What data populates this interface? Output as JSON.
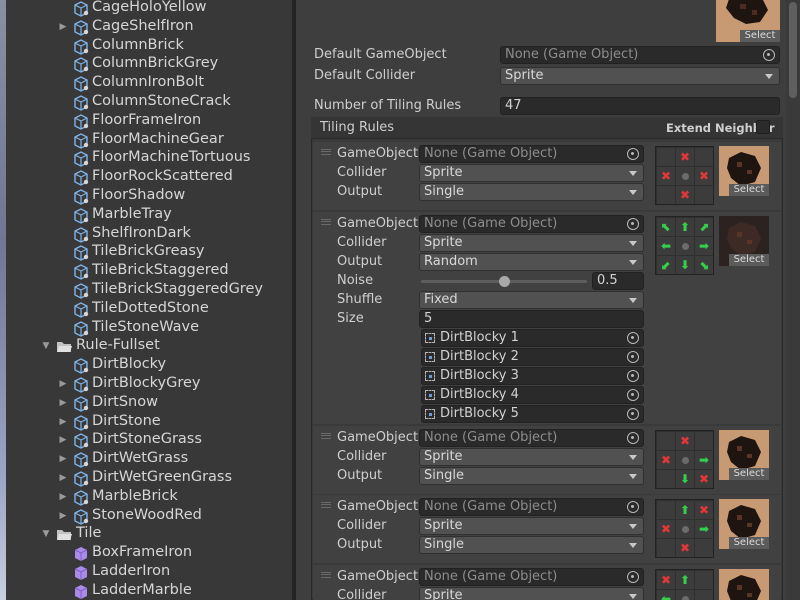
{
  "hierarchy": {
    "items": [
      {
        "label": "CageHoloYellow",
        "kind": "tile",
        "arrow": false
      },
      {
        "label": "CageShelfIron",
        "kind": "tile",
        "arrow": true
      },
      {
        "label": "ColumnBrick",
        "kind": "tile",
        "arrow": false
      },
      {
        "label": "ColumnBrickGrey",
        "kind": "tile",
        "arrow": false
      },
      {
        "label": "ColumnIronBolt",
        "kind": "tile",
        "arrow": false
      },
      {
        "label": "ColumnStoneCrack",
        "kind": "tile",
        "arrow": false
      },
      {
        "label": "FloorFrameIron",
        "kind": "tile",
        "arrow": false
      },
      {
        "label": "FloorMachineGear",
        "kind": "tile",
        "arrow": false
      },
      {
        "label": "FloorMachineTortuous",
        "kind": "tile",
        "arrow": false
      },
      {
        "label": "FloorRockScattered",
        "kind": "tile",
        "arrow": false
      },
      {
        "label": "FloorShadow",
        "kind": "tile",
        "arrow": false
      },
      {
        "label": "MarbleTray",
        "kind": "tile",
        "arrow": false
      },
      {
        "label": "ShelfIronDark",
        "kind": "tile",
        "arrow": false
      },
      {
        "label": "TileBrickGreasy",
        "kind": "tile",
        "arrow": false
      },
      {
        "label": "TileBrickStaggered",
        "kind": "tile",
        "arrow": false
      },
      {
        "label": "TileBrickStaggeredGrey",
        "kind": "tile",
        "arrow": false
      },
      {
        "label": "TileDottedStone",
        "kind": "tile",
        "arrow": false
      },
      {
        "label": "TileStoneWave",
        "kind": "tile",
        "arrow": false
      },
      {
        "label": "Rule-Fullset",
        "kind": "folder",
        "arrow": "open"
      },
      {
        "label": "DirtBlocky",
        "kind": "tile",
        "arrow": false
      },
      {
        "label": "DirtBlockyGrey",
        "kind": "tile",
        "arrow": true
      },
      {
        "label": "DirtSnow",
        "kind": "tile",
        "arrow": true
      },
      {
        "label": "DirtStone",
        "kind": "tile",
        "arrow": true
      },
      {
        "label": "DirtStoneGrass",
        "kind": "tile",
        "arrow": true
      },
      {
        "label": "DirtWetGrass",
        "kind": "tile",
        "arrow": true
      },
      {
        "label": "DirtWetGreenGrass",
        "kind": "tile",
        "arrow": true
      },
      {
        "label": "MarbleBrick",
        "kind": "tile",
        "arrow": true
      },
      {
        "label": "StoneWoodRed",
        "kind": "tile",
        "arrow": true
      },
      {
        "label": "Tile",
        "kind": "folder",
        "arrow": "open"
      },
      {
        "label": "BoxFrameIron",
        "kind": "asset",
        "arrow": false
      },
      {
        "label": "LadderIron",
        "kind": "asset",
        "arrow": false
      },
      {
        "label": "LadderMarble",
        "kind": "asset",
        "arrow": false
      }
    ]
  },
  "inspector": {
    "top_sprite_select": "Select",
    "default_gameobject_label": "Default GameObject",
    "default_gameobject_value": "None (Game Object)",
    "default_collider_label": "Default Collider",
    "default_collider_value": "Sprite",
    "num_rules_label": "Number of Tiling Rules",
    "num_rules_value": "47",
    "tiling_rules_label": "Tiling Rules",
    "extend_neighbor_label": "Extend Neighbor",
    "extend_neighbor_checked": false
  },
  "labels": {
    "gameobject": "GameObject",
    "collider": "Collider",
    "output": "Output",
    "noise": "Noise",
    "shuffle": "Shuffle",
    "size": "Size",
    "select": "Select"
  },
  "rules": [
    {
      "gameobject": "None (Game Object)",
      "collider": "Sprite",
      "output": "Single",
      "grid": [
        "",
        "x",
        "",
        "x",
        "c",
        "x",
        "",
        "x",
        ""
      ]
    },
    {
      "gameobject": "None (Game Object)",
      "collider": "Sprite",
      "output": "Random",
      "noise": "0.5",
      "noise_fraction": 0.5,
      "shuffle": "Fixed",
      "size": "5",
      "sprites": [
        "DirtBlocky 1",
        "DirtBlocky 2",
        "DirtBlocky 3",
        "DirtBlocky 4",
        "DirtBlocky 5"
      ],
      "grid": [
        "ul",
        "u",
        "ur",
        "l",
        "c",
        "r",
        "dl",
        "d",
        "dr"
      ]
    },
    {
      "gameobject": "None (Game Object)",
      "collider": "Sprite",
      "output": "Single",
      "grid": [
        "",
        "x",
        "",
        "x",
        "c",
        "r",
        "",
        "d",
        "x"
      ]
    },
    {
      "gameobject": "None (Game Object)",
      "collider": "Sprite",
      "output": "Single",
      "grid": [
        "",
        "u",
        "x",
        "x",
        "c",
        "r",
        "",
        "x",
        ""
      ]
    },
    {
      "gameobject": "None (Game Object)",
      "collider": "Sprite",
      "output": "",
      "grid": [
        "x",
        "u",
        "",
        "l",
        "c",
        "",
        "",
        "",
        ""
      ]
    }
  ],
  "colors": {
    "arrow_green": "#35d04a",
    "cross_red": "#e03838",
    "sprite_tan": "#c89a74",
    "cube_blue": "#7fb4e6",
    "asset_purple": "#a98ce8"
  }
}
